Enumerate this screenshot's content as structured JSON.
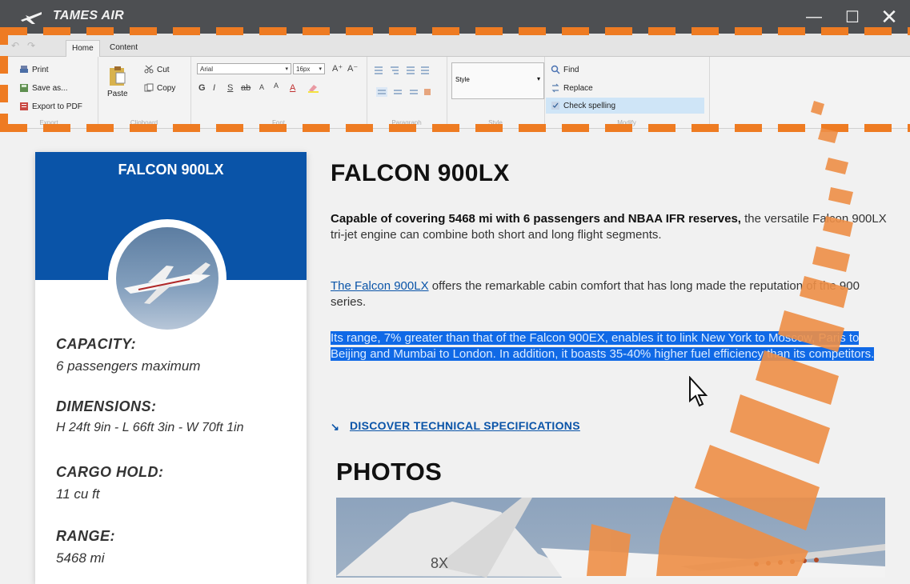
{
  "app": {
    "title": "TAMES AIR",
    "controls": {
      "minimize": "—",
      "maximize": "☐",
      "close": "✕"
    }
  },
  "quick_access": {
    "undo": "↶",
    "redo": "↷"
  },
  "ribbon": {
    "tabs": [
      {
        "label": "Home",
        "active": true
      },
      {
        "label": "Content",
        "active": false
      }
    ],
    "groups": {
      "export": {
        "label": "Export",
        "items": [
          {
            "label": "Print",
            "icon": "print-icon"
          },
          {
            "label": "Save as...",
            "icon": "save-icon"
          },
          {
            "label": "Export to PDF",
            "icon": "pdf-icon"
          }
        ]
      },
      "clipboard": {
        "label": "Clipboard",
        "paste": "Paste",
        "cut": "Cut",
        "copy": "Copy"
      },
      "font": {
        "label": "Font",
        "family": "Arial",
        "size": "16px",
        "buttons": [
          "A⁺",
          "A⁻",
          "G",
          "I",
          "S",
          "ab",
          "A",
          "A",
          "A"
        ]
      },
      "paragraph": {
        "label": "Paragraph"
      },
      "style": {
        "label": "Style",
        "value": "Style"
      },
      "modify": {
        "label": "Modify",
        "find": "Find",
        "replace": "Replace",
        "check_spelling": "Check spelling"
      }
    }
  },
  "sidebar": {
    "title": "FALCON 900LX",
    "specs": [
      {
        "label": "CAPACITY:",
        "value": "6 passengers maximum"
      },
      {
        "label": "DIMENSIONS:",
        "value": "H 24ft 9in - L 66ft 3in - W 70ft 1in"
      },
      {
        "label": "CARGO HOLD:",
        "value": "11 cu ft"
      },
      {
        "label": "RANGE:",
        "value": "5468 mi"
      }
    ]
  },
  "article": {
    "title": "FALCON 900LX",
    "p1_bold": "Capable of covering 5468 mi with 6 passengers and NBAA IFR reserves,",
    "p1_rest": "the versatile Falcon 900LX tri-jet engine can combine both short and long flight segments.",
    "p2_link": "The Falcon 900LX",
    "p2_rest": "offers the remarkable cabin comfort that has long made the reputation of the 900 series.",
    "p3_selected": "Its range, 7% greater than that of the Falcon 900EX, enables it to link New York to Moscow, Paris to Beijing and Mumbai to London. In addition, it boasts 35-40% higher fuel efficiency than its competitors.",
    "discover_link": "DISCOVER TECHNICAL SPECIFICATIONS",
    "photos_heading": "PHOTOS",
    "photo_tail_text": "8X"
  },
  "colors": {
    "brand": "#0a54a8",
    "selection": "#1069e6",
    "accent": "#ee7b22",
    "titlebar": "#4d4f52"
  }
}
